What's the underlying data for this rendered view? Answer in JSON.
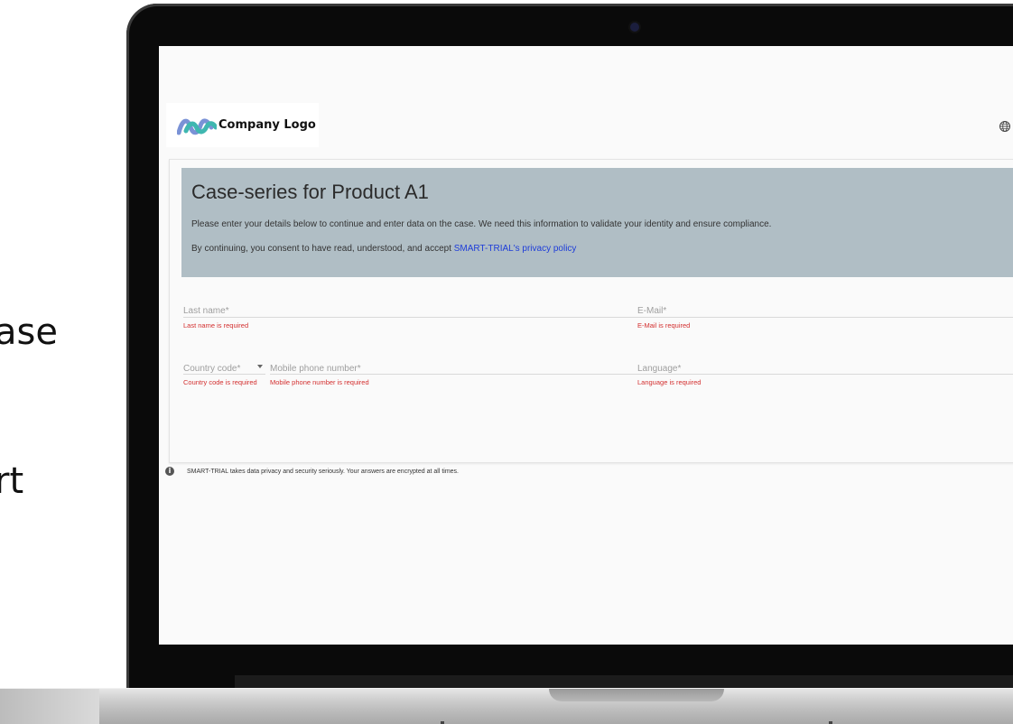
{
  "background_text": {
    "line1": "ase",
    "line2": "rt"
  },
  "app": {
    "logo_text": "Company Logo",
    "language_icon": "globe-icon"
  },
  "header": {
    "title": "Case-series for Product A1",
    "description": "Please enter your details below to continue and enter data on the case. We need this information to validate your identity and ensure compliance.",
    "consent_prefix": "By continuing, you consent to have read, understood, and accept ",
    "privacy_link": "SMART-TRIAL's privacy policy",
    "background_color": "#b0bec5"
  },
  "form": {
    "last_name": {
      "label": "Last name",
      "required_mark": "*",
      "value": "",
      "error": "Last name is required"
    },
    "email": {
      "label": "E-Mail",
      "required_mark": "*",
      "value": "",
      "error": "E-Mail is required"
    },
    "country_code": {
      "label": "Country code",
      "required_mark": "*",
      "value": "",
      "error": "Country code is required"
    },
    "mobile_phone": {
      "label": "Mobile phone number",
      "required_mark": "*",
      "value": "",
      "error": "Mobile phone number is required"
    },
    "language": {
      "label": "Language",
      "required_mark": "*",
      "value": "",
      "error": "Language is required"
    }
  },
  "footer": {
    "info_icon": "info-icon",
    "info_symbol": "i",
    "note": "SMART-TRIAL takes data privacy and security seriously. Your answers are encrypted at all times."
  },
  "colors": {
    "error": "#d32f2f",
    "link": "#1e3dd9",
    "label": "#9e9e9e"
  }
}
